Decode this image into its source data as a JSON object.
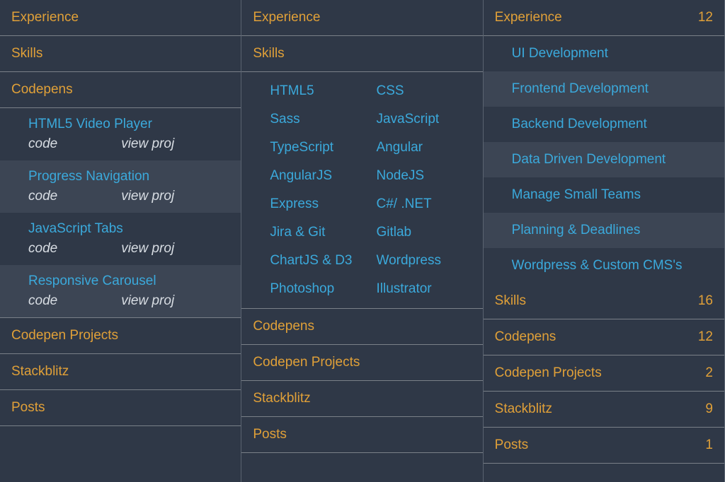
{
  "sections": {
    "experience": "Experience",
    "skills": "Skills",
    "codepens": "Codepens",
    "codepen_projects": "Codepen Projects",
    "stackblitz": "Stackblitz",
    "posts": "Posts"
  },
  "panel1": {
    "codepens": [
      {
        "title": "HTML5 Video Player",
        "code": "code",
        "view": "view proj"
      },
      {
        "title": "Progress Navigation",
        "code": "code",
        "view": "view proj"
      },
      {
        "title": "JavaScript Tabs",
        "code": "code",
        "view": "view proj"
      },
      {
        "title": "Responsive Carousel",
        "code": "code",
        "view": "view proj"
      }
    ]
  },
  "panel2": {
    "skills": [
      "HTML5",
      "CSS",
      "Sass",
      "JavaScript",
      "TypeScript",
      "Angular",
      "AngularJS",
      "NodeJS",
      "Express",
      "C#/ .NET",
      "Jira & Git",
      "Gitlab",
      "ChartJS & D3",
      "Wordpress",
      "Photoshop",
      "Illustrator"
    ]
  },
  "panel3": {
    "counts": {
      "experience": "12",
      "skills": "16",
      "codepens": "12",
      "codepen_projects": "2",
      "stackblitz": "9",
      "posts": "1"
    },
    "experience": [
      "UI Development",
      "Frontend Development",
      "Backend Development",
      "Data Driven Development",
      "Manage Small Teams",
      "Planning & Deadlines",
      "Wordpress & Custom CMS's"
    ]
  }
}
